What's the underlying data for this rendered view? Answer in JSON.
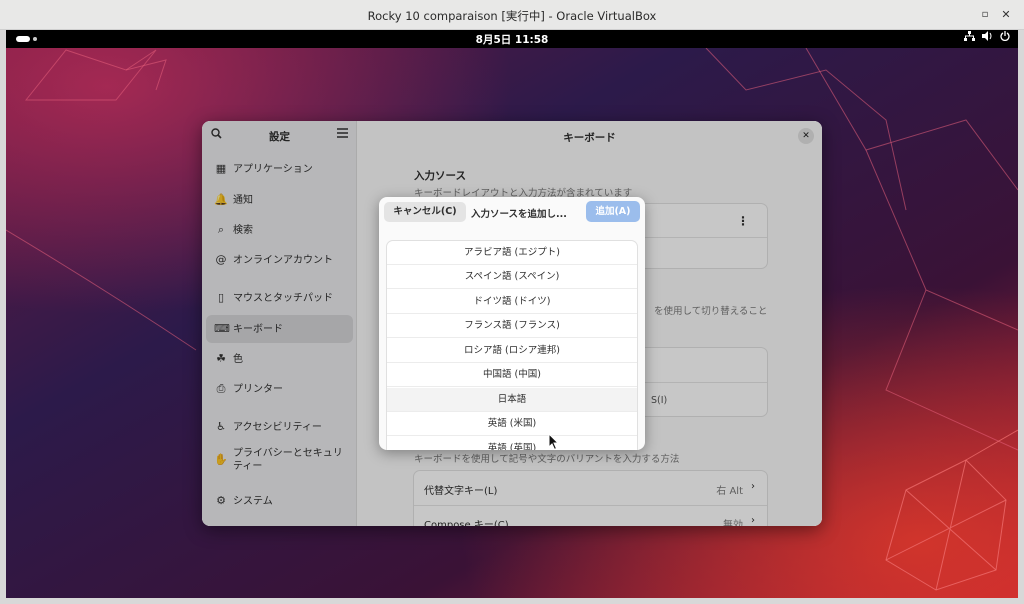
{
  "host_window": {
    "title": "Rocky 10 comparaison [実行中] - Oracle VirtualBox",
    "restore_glyph": "▫",
    "close_glyph": "✕"
  },
  "topbar": {
    "clock": "8月5日  11:58",
    "network_icon": "network-icon",
    "volume_icon": "volume-icon",
    "power_icon": "power-icon"
  },
  "settings": {
    "sidebar_title": "設定",
    "search_icon": "search-icon",
    "menu_icon": "hamburger-menu-icon",
    "items": [
      {
        "icon": "apps-grid-icon",
        "glyph": "▦",
        "label": "アプリケーション",
        "active": false
      },
      {
        "icon": "bell-icon",
        "glyph": "🔔",
        "label": "通知",
        "active": false
      },
      {
        "icon": "search-icon",
        "glyph": "⌕",
        "label": "検索",
        "active": false
      },
      {
        "icon": "at-icon",
        "glyph": "@",
        "label": "オンラインアカウント",
        "active": false
      },
      {
        "icon": "mouse-icon",
        "glyph": "▯",
        "label": "マウスとタッチパッド",
        "active": false
      },
      {
        "icon": "keyboard-icon",
        "glyph": "⌨",
        "label": "キーボード",
        "active": true
      },
      {
        "icon": "color-icon",
        "glyph": "☘",
        "label": "色",
        "active": false
      },
      {
        "icon": "printer-icon",
        "glyph": "⎙",
        "label": "プリンター",
        "active": false
      },
      {
        "icon": "accessibility-icon",
        "glyph": "♿",
        "label": "アクセシビリティー",
        "active": false
      },
      {
        "icon": "privacy-hand-icon",
        "glyph": "✋",
        "label": "プライバシーとセキュリティー",
        "active": false
      },
      {
        "icon": "system-gear-icon",
        "glyph": "⚙",
        "label": "システム",
        "active": false
      }
    ],
    "main_title": "キーボード",
    "input_sources_title": "入力ソース",
    "input_sources_sub": "キーボードレイアウトと入力方法が含まれています",
    "switch_hint_fragment": "を使用して切り替えること",
    "paren_fragment": "S(I)",
    "special_chars_sub": "キーボードを使用して記号や文字のバリアントを入力する方法",
    "rows": [
      {
        "label": "代替文字キー(L)",
        "value": "右 Alt"
      },
      {
        "label": "Compose キー(C)",
        "value": "無効"
      }
    ]
  },
  "dialog": {
    "cancel_label": "キャンセル(C)",
    "title": "入力ソースを追加し...",
    "add_label": "追加(A)",
    "languages": [
      "アラビア語 (エジプト)",
      "スペイン語 (スペイン)",
      "ドイツ語 (ドイツ)",
      "フランス語 (フランス)",
      "ロシア語 (ロシア連邦)",
      "中国語 (中国)",
      "日本語",
      "英語 (米国)",
      "英語 (英国)"
    ],
    "hovered_language": "日本語"
  }
}
